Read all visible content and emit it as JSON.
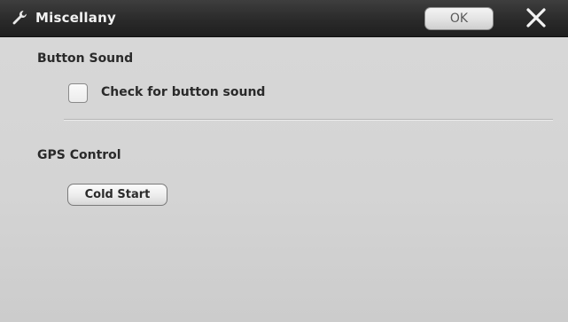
{
  "window": {
    "title": "Miscellany",
    "title_icon": "wrench-icon",
    "ok_label": "OK",
    "close_icon": "close-icon"
  },
  "button_sound": {
    "heading": "Button Sound",
    "checkbox_label": "Check for button sound",
    "checked": false
  },
  "gps_control": {
    "heading": "GPS Control",
    "cold_start_label": "Cold Start"
  },
  "colors": {
    "titlebar": "#2a2a2a",
    "background": "#d6d6d6",
    "text": "#2a2a2a"
  }
}
